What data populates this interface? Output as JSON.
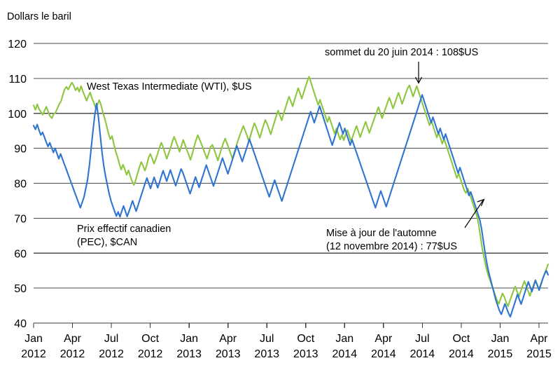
{
  "chart_data": {
    "type": "line",
    "title": "",
    "ylabel": "Dollars le baril",
    "xlabel": "",
    "ylim": [
      40,
      120
    ],
    "ytick_values": [
      40,
      50,
      60,
      70,
      80,
      90,
      100,
      110,
      120
    ],
    "grid": true,
    "legend": "inline-labels",
    "xtick_labels": [
      {
        "month": "Jan",
        "year": "2012"
      },
      {
        "month": "Apr",
        "year": "2012"
      },
      {
        "month": "Jul",
        "year": "2012"
      },
      {
        "month": "Oct",
        "year": "2012"
      },
      {
        "month": "Jan",
        "year": "2013"
      },
      {
        "month": "Apr",
        "year": "2013"
      },
      {
        "month": "Jul",
        "year": "2013"
      },
      {
        "month": "Oct",
        "year": "2013"
      },
      {
        "month": "Jan",
        "year": "2014"
      },
      {
        "month": "Apr",
        "year": "2014"
      },
      {
        "month": "Jul",
        "year": "2014"
      },
      {
        "month": "Oct",
        "year": "2014"
      },
      {
        "month": "Jan",
        "year": "2015"
      },
      {
        "month": "Apr",
        "year": "2015"
      }
    ],
    "x_start": "2012-01",
    "x_end": "2015-05",
    "series": [
      {
        "name": "West Texas Intermediate (WTI), $US",
        "color": "#8DC63F",
        "label_text": "West Texas Intermediate (WTI), $US",
        "values": [
          102.3,
          101.0,
          102.6,
          101.2,
          100.4,
          99.6,
          100.8,
          101.9,
          100.5,
          99.2,
          98.6,
          99.8,
          100.2,
          101.4,
          102.6,
          103.4,
          105.2,
          106.9,
          107.6,
          106.8,
          107.9,
          108.8,
          107.9,
          106.6,
          107.4,
          106.2,
          107.8,
          106.3,
          105.0,
          103.6,
          104.9,
          106.0,
          104.3,
          103.1,
          101.6,
          102.5,
          103.8,
          102.3,
          100.2,
          98.5,
          96.5,
          94.3,
          92.6,
          93.5,
          91.2,
          89.1,
          87.5,
          85.6,
          83.9,
          85.3,
          84.0,
          82.4,
          83.7,
          82.0,
          80.6,
          79.5,
          81.0,
          82.8,
          84.6,
          86.1,
          85.0,
          83.6,
          85.2,
          87.3,
          88.4,
          87.1,
          85.6,
          86.9,
          88.5,
          90.2,
          91.6,
          90.4,
          88.6,
          87.0,
          88.5,
          90.0,
          91.8,
          93.3,
          92.0,
          90.5,
          89.0,
          90.7,
          92.4,
          91.0,
          89.5,
          88.2,
          86.7,
          88.4,
          90.6,
          92.3,
          93.8,
          92.5,
          91.2,
          89.8,
          88.4,
          87.0,
          88.6,
          90.4,
          91.0,
          89.6,
          88.1,
          86.5,
          88.2,
          89.9,
          91.5,
          92.8,
          91.4,
          90.0,
          88.5,
          87.0,
          88.8,
          90.5,
          92.2,
          93.7,
          95.1,
          96.4,
          95.0,
          93.6,
          92.0,
          93.8,
          95.6,
          97.2,
          96.0,
          94.5,
          93.0,
          94.8,
          96.5,
          98.1,
          97.0,
          95.5,
          94.0,
          95.8,
          97.5,
          99.2,
          100.8,
          99.4,
          98.0,
          99.8,
          101.5,
          103.2,
          104.8,
          103.4,
          102.0,
          103.8,
          105.5,
          107.2,
          105.8,
          104.2,
          105.9,
          107.6,
          109.2,
          110.5,
          108.9,
          107.2,
          105.6,
          104.0,
          102.4,
          103.9,
          102.3,
          100.7,
          99.1,
          97.5,
          99.0,
          97.4,
          95.8,
          94.2,
          95.7,
          94.1,
          92.5,
          93.9,
          92.3,
          93.8,
          95.2,
          93.6,
          92.0,
          93.5,
          95.0,
          96.4,
          94.8,
          93.2,
          94.7,
          96.2,
          97.6,
          96.0,
          94.4,
          95.9,
          97.4,
          98.9,
          100.3,
          101.8,
          100.2,
          98.6,
          100.1,
          101.6,
          103.1,
          104.5,
          103.0,
          101.4,
          102.9,
          104.4,
          105.9,
          104.3,
          102.7,
          104.2,
          105.7,
          107.2,
          108.0,
          106.4,
          104.8,
          106.3,
          107.8,
          106.2,
          104.6,
          103.0,
          101.4,
          99.8,
          98.2,
          96.6,
          97.9,
          96.3,
          94.7,
          93.1,
          94.5,
          92.9,
          91.3,
          92.7,
          91.1,
          89.5,
          87.9,
          86.3,
          84.7,
          83.1,
          81.5,
          82.8,
          81.2,
          79.6,
          78.0,
          77.2,
          78.5,
          77.0,
          75.4,
          73.8,
          72.2,
          70.6,
          68.0,
          64.5,
          61.0,
          58.5,
          56.0,
          54.0,
          52.5,
          51.0,
          49.5,
          48.0,
          46.5,
          45.5,
          47.0,
          48.5,
          47.5,
          46.0,
          44.8,
          46.3,
          47.8,
          49.2,
          50.5,
          49.0,
          47.6,
          49.1,
          50.6,
          52.0,
          50.6,
          49.2,
          47.8,
          49.3,
          50.8,
          52.3,
          51.0,
          49.6,
          51.1,
          52.6,
          54.0,
          55.4,
          56.8
        ]
      },
      {
        "name": "Prix effectif canadien (PEC), $CAN",
        "color": "#2E74D0",
        "label_line1": "Prix effectif canadien",
        "label_line2": "(PEC), $CAN",
        "values": [
          96.5,
          95.4,
          96.8,
          95.2,
          93.8,
          94.6,
          93.2,
          91.8,
          90.5,
          91.6,
          90.2,
          88.8,
          90.0,
          88.5,
          87.0,
          88.4,
          87.0,
          85.6,
          84.2,
          82.8,
          81.4,
          80.0,
          78.6,
          77.2,
          75.8,
          74.4,
          73.0,
          74.5,
          76.0,
          78.5,
          81.0,
          85.0,
          90.0,
          95.0,
          99.5,
          102.8,
          99.0,
          94.0,
          89.0,
          85.0,
          82.0,
          79.5,
          77.0,
          75.0,
          73.5,
          72.0,
          70.6,
          71.8,
          70.4,
          72.0,
          73.5,
          72.0,
          70.5,
          71.9,
          73.4,
          75.0,
          73.5,
          72.0,
          73.6,
          75.2,
          76.8,
          78.4,
          80.0,
          81.5,
          80.0,
          78.5,
          80.1,
          81.7,
          80.2,
          78.7,
          80.3,
          82.0,
          83.6,
          82.1,
          80.6,
          82.2,
          83.8,
          82.3,
          80.8,
          79.3,
          80.9,
          82.5,
          84.1,
          83.0,
          81.5,
          80.0,
          78.5,
          77.0,
          78.6,
          80.2,
          81.8,
          80.3,
          78.8,
          80.4,
          82.0,
          83.6,
          85.2,
          83.7,
          82.2,
          80.7,
          79.2,
          80.8,
          82.4,
          84.0,
          85.6,
          87.2,
          85.7,
          84.2,
          82.7,
          84.3,
          85.9,
          87.5,
          89.1,
          90.7,
          89.2,
          87.7,
          86.2,
          87.8,
          89.4,
          91.0,
          92.6,
          91.1,
          89.6,
          88.1,
          86.6,
          85.1,
          83.6,
          82.1,
          80.6,
          79.1,
          77.6,
          76.1,
          77.7,
          79.3,
          80.9,
          79.4,
          77.9,
          76.4,
          74.9,
          76.5,
          78.1,
          79.7,
          81.3,
          82.9,
          84.5,
          86.1,
          87.7,
          89.3,
          90.9,
          92.5,
          94.1,
          95.7,
          97.3,
          98.9,
          100.5,
          98.9,
          97.3,
          98.9,
          100.5,
          102.1,
          100.5,
          98.9,
          97.3,
          95.7,
          94.1,
          92.5,
          90.9,
          92.5,
          94.1,
          95.7,
          97.3,
          95.7,
          94.1,
          95.7,
          94.1,
          92.5,
          90.9,
          92.5,
          91.0,
          89.5,
          88.0,
          86.5,
          85.0,
          83.5,
          82.0,
          80.5,
          79.0,
          77.5,
          76.0,
          74.5,
          73.0,
          74.6,
          76.2,
          77.8,
          76.3,
          74.8,
          73.3,
          74.9,
          76.5,
          78.1,
          79.7,
          81.3,
          82.9,
          84.5,
          86.1,
          87.7,
          89.3,
          90.9,
          92.5,
          94.1,
          95.7,
          97.3,
          98.9,
          100.5,
          102.1,
          103.7,
          105.3,
          103.7,
          102.1,
          100.5,
          98.9,
          97.3,
          98.9,
          97.3,
          95.7,
          94.1,
          95.7,
          94.1,
          92.5,
          94.1,
          92.5,
          90.9,
          89.3,
          87.7,
          86.1,
          84.5,
          82.9,
          84.5,
          82.9,
          81.3,
          79.7,
          78.1,
          76.5,
          77.5,
          76.0,
          74.4,
          72.8,
          71.2,
          69.6,
          67.0,
          63.5,
          60.0,
          57.0,
          54.5,
          52.5,
          50.5,
          48.5,
          46.5,
          45.0,
          43.5,
          42.5,
          44.0,
          45.5,
          44.2,
          42.8,
          41.8,
          43.4,
          45.0,
          46.6,
          48.2,
          46.8,
          45.4,
          47.0,
          48.6,
          50.2,
          51.8,
          50.4,
          49.0,
          50.6,
          52.2,
          50.8,
          49.4,
          51.0,
          52.6,
          54.0,
          55.0,
          53.8
        ]
      }
    ],
    "annotations": [
      {
        "id": "peak-annotation",
        "text": "sommet du 20 juin 2014 : 108$US",
        "value": 108,
        "date": "2014-06-20"
      },
      {
        "id": "fall-update-annotation",
        "line1": "Mise à jour de l'automne",
        "line2": "(12 novembre 2014) : 77$US",
        "value": 77,
        "date": "2014-11-12"
      }
    ]
  }
}
